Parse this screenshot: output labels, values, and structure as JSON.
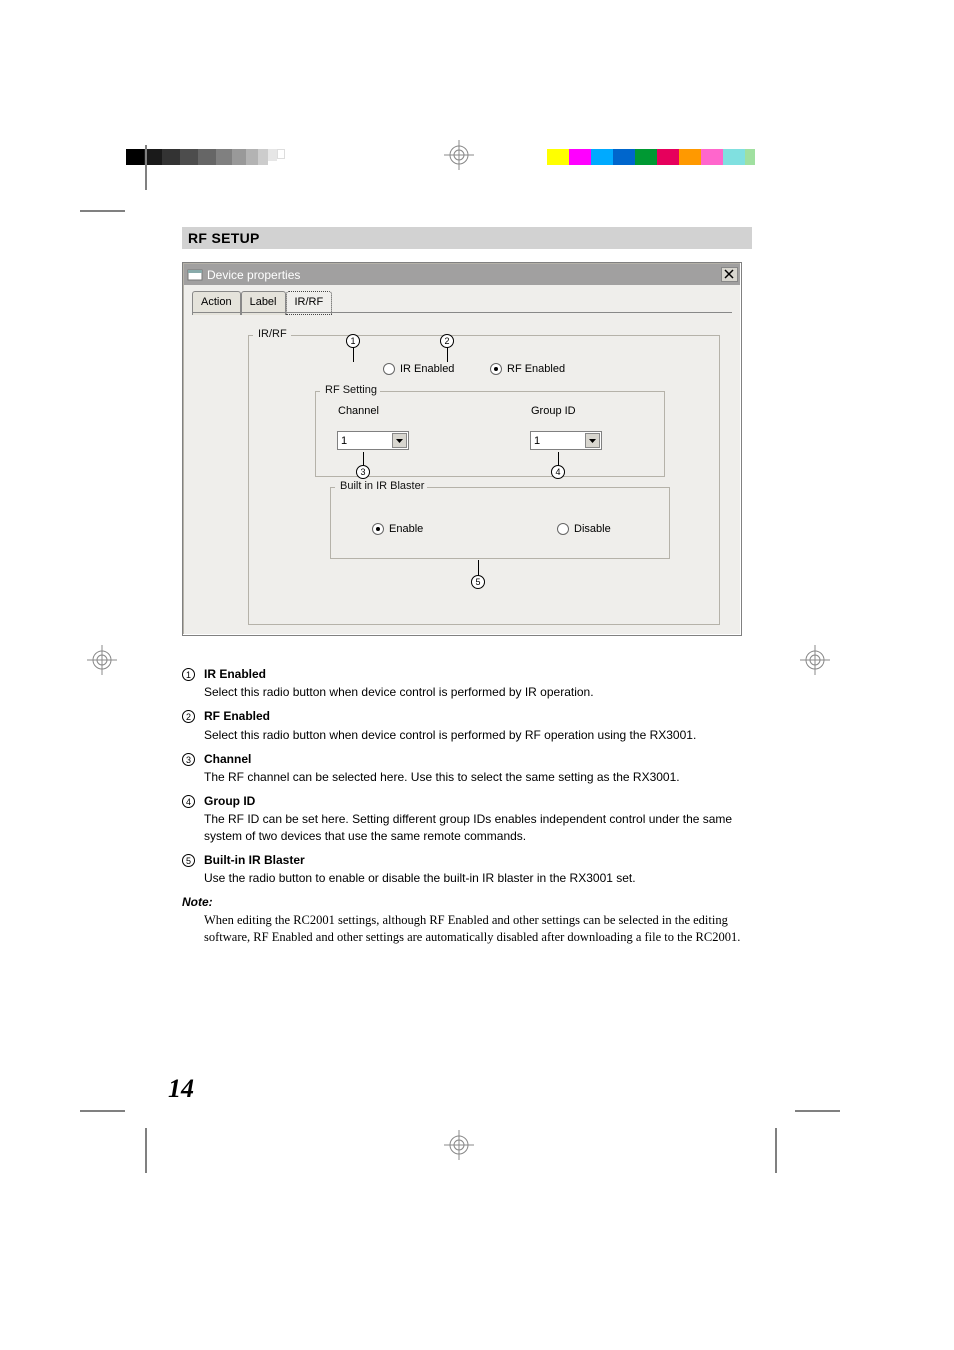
{
  "section_title": "RF SETUP",
  "dialog": {
    "title": "Device properties",
    "tabs": [
      "Action",
      "Label",
      "IR/RF"
    ],
    "active_tab": 2,
    "group_irrf_label": "IR/RF",
    "radio_ir": "IR Enabled",
    "radio_rf": "RF Enabled",
    "group_rfset_label": "RF Setting",
    "channel_label": "Channel",
    "channel_value": "1",
    "group_label": "Group ID",
    "group_value": "1",
    "group_blaster_label": "Built in IR Blaster",
    "radio_enable": "Enable",
    "radio_disable": "Disable"
  },
  "callouts": [
    "1",
    "2",
    "3",
    "4",
    "5"
  ],
  "items": [
    {
      "num": "1",
      "title": "IR Enabled",
      "text": "Select this radio button when device control is performed by IR operation."
    },
    {
      "num": "2",
      "title": "RF Enabled",
      "text": "Select this radio button when device control is performed by RF operation using the RX3001."
    },
    {
      "num": "3",
      "title": "Channel",
      "text": "The RF channel can be selected here. Use this to select the same setting as the RX3001."
    },
    {
      "num": "4",
      "title": "Group ID",
      "text": "The RF ID can be set here. Setting different group IDs enables independent control under the same system of two devices that use the same remote commands."
    },
    {
      "num": "5",
      "title": "Built-in IR Blaster",
      "text": "Use the radio button to enable or disable the built-in IR blaster in the RX3001 set."
    }
  ],
  "note_heading": "Note:",
  "note_text": "When editing the RC2001 settings, although RF Enabled and other settings can be selected in the editing software, RF Enabled and other settings are automatically disabled after downloading a file to the RC2001.",
  "page_number": "14",
  "colorbar_left": [
    "#000000",
    "#1a1a1a",
    "#333333",
    "#4d4d4d",
    "#666666",
    "#808080",
    "#999999",
    "#b3b3b3",
    "#cccccc",
    "#e6e6e6",
    "#ffffff"
  ],
  "colorbar_right": [
    "#ffff00",
    "#ff00ff",
    "#00aaff",
    "#0066cc",
    "#009933",
    "#e6005c",
    "#ff9900",
    "#ff66cc",
    "#80e0e0",
    "#a0e0a0"
  ],
  "icon_names": {
    "close": "close-icon",
    "chevron": "chevron-down-icon",
    "reg": "registration-mark-icon"
  }
}
